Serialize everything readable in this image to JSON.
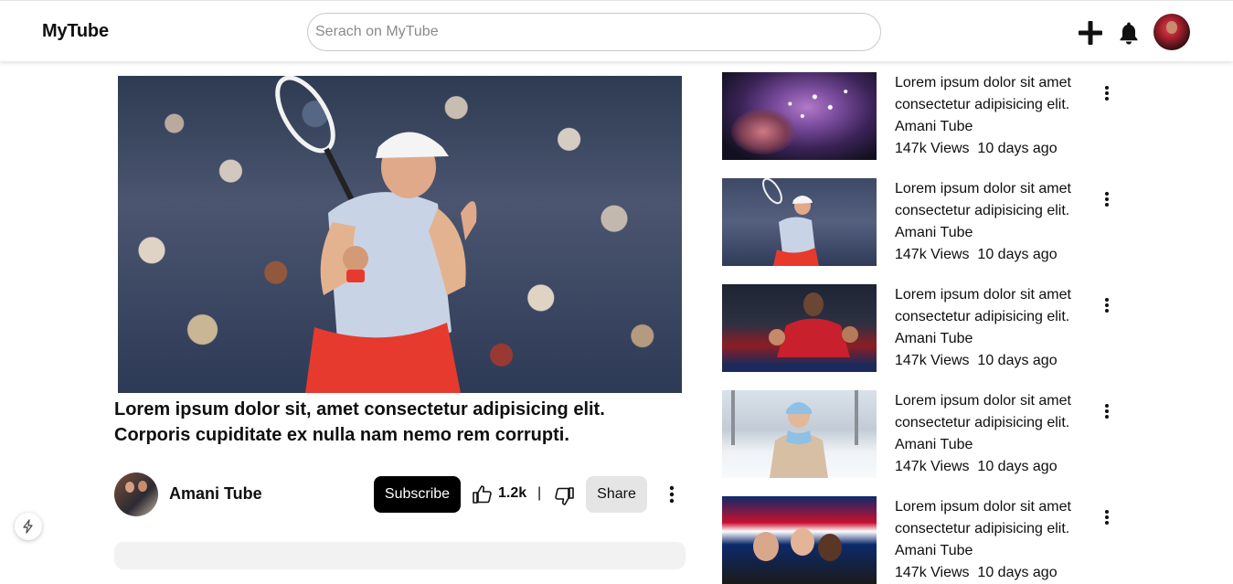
{
  "header": {
    "logo": "MyTube",
    "search_placeholder": "Serach on MyTube",
    "create_icon": "plus-icon",
    "notifications_icon": "bell-icon"
  },
  "video": {
    "title": "Lorem ipsum dolor sit, amet consectetur adipisicing elit. Corporis cupiditate ex nulla nam nemo rem corrupti.",
    "channel": "Amani Tube",
    "subscribe_label": "Subscribe",
    "likes": "1.2k",
    "separator": "|",
    "share_label": "Share"
  },
  "recommendations": [
    {
      "title": "Lorem ipsum dolor sit amet consectetur adipisicing elit.",
      "channel": "Amani Tube",
      "views": "147k Views",
      "age": "10 days ago",
      "thumb": "space"
    },
    {
      "title": "Lorem ipsum dolor sit amet consectetur adipisicing elit.",
      "channel": "Amani Tube",
      "views": "147k Views",
      "age": "10 days ago",
      "thumb": "tennis"
    },
    {
      "title": "Lorem ipsum dolor sit amet consectetur adipisicing elit.",
      "channel": "Amani Tube",
      "views": "147k Views",
      "age": "10 days ago",
      "thumb": "football"
    },
    {
      "title": "Lorem ipsum dolor sit amet consectetur adipisicing elit.",
      "channel": "Amani Tube",
      "views": "147k Views",
      "age": "10 days ago",
      "thumb": "snow"
    },
    {
      "title": "Lorem ipsum dolor sit amet consectetur adipisicing elit.",
      "channel": "Amani Tube",
      "views": "147k Views",
      "age": "10 days ago",
      "thumb": "news"
    }
  ],
  "colors": {
    "subscribe_bg": "#000000",
    "share_bg": "#e5e5e5"
  }
}
